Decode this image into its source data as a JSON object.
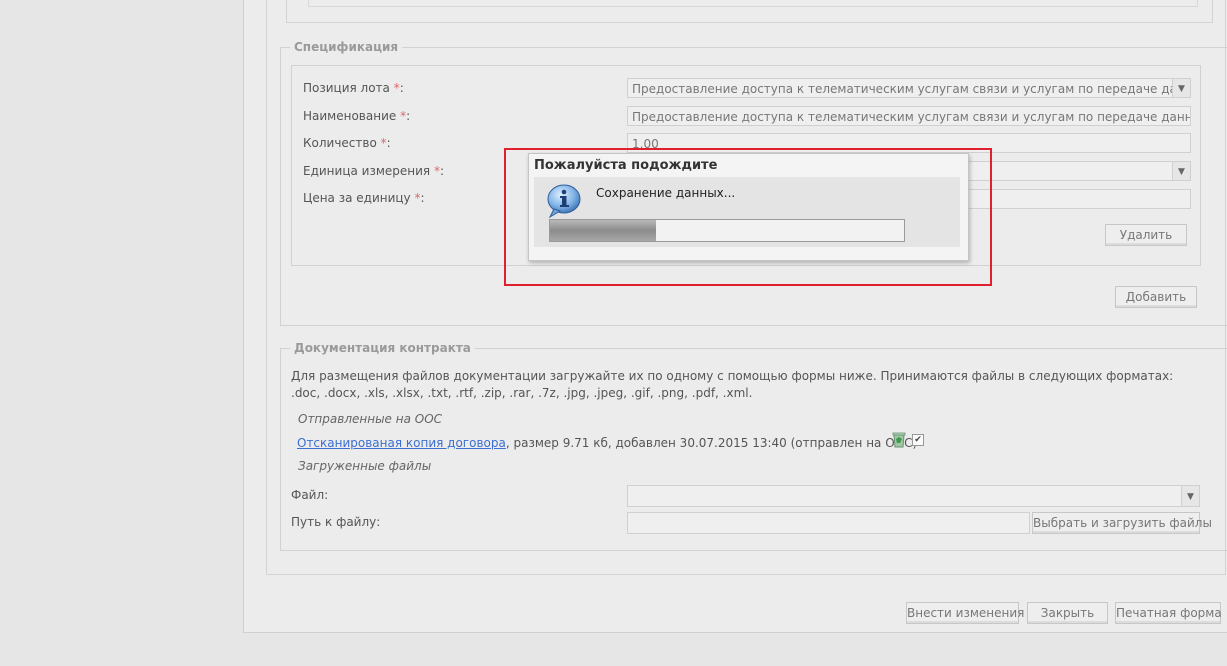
{
  "specification": {
    "legend": "Спецификация",
    "fields": [
      {
        "label": "Позиция лота",
        "req": "*",
        "suffix": ":",
        "value": "Предоставление доступа к телематическим услугам связи и услугам по передаче данных,"
      },
      {
        "label": "Наименование",
        "req": "*",
        "suffix": ":",
        "value": "Предоставление доступа к телематическим услугам связи и услугам по передаче данных, за"
      },
      {
        "label": "Количество",
        "req": "*",
        "suffix": ":",
        "value": "1,00"
      },
      {
        "label": "Единица измерения",
        "req": "*",
        "suffix": ":",
        "value": ""
      },
      {
        "label": "Цена за единицу",
        "req": "*",
        "suffix": ":",
        "value": ""
      }
    ],
    "delete_label": "Удалить",
    "add_label": "Добавить"
  },
  "dialog": {
    "title": "Пожалуйста подождите",
    "message": "Сохранение данных...",
    "progress": 0.3
  },
  "contract_docs": {
    "legend": "Документация контракта",
    "description": "Для размещения файлов документации загружайте их по одному с помощью формы ниже. Принимаются файлы в следующих форматах: .doc, .docx, .xls, .xlsx, .txt, .rtf, .zip, .rar, .7z, .jpg, .jpeg, .gif, .png, .pdf, .xml.",
    "sent_heading": "Отправленные на ООС",
    "file_link": "Отсканированая копия договора",
    "file_info": ", размер 9.71 кб, добавлен 30.07.2015 13:40 (отправлен на ООС)",
    "uploaded_heading": "Загруженные файлы",
    "file_label": "Файл:",
    "path_label": "Путь к файлу:",
    "upload_button": "Выбрать и загрузить файлы"
  },
  "footer": {
    "save_label": "Внести изменения",
    "close_label": "Закрыть",
    "print_label": "Печатная форма"
  },
  "colors": {
    "highlight": "#e0202c",
    "link": "#3c6fd1",
    "required": "#d66"
  }
}
